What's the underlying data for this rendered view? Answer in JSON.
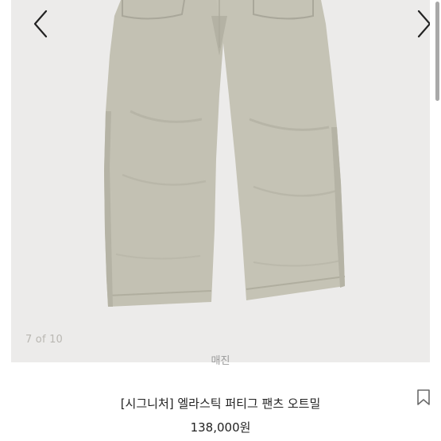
{
  "gallery": {
    "counter": "7 of 10",
    "prev_icon": "chevron-left-icon",
    "next_icon": "chevron-right-icon"
  },
  "product": {
    "brand": "매진",
    "title": "[시그니처] 엘라스틱 퍼티그 팬츠 오트밀",
    "price": "138,000원",
    "bookmark_icon": "bookmark-icon"
  },
  "colors": {
    "gallery_bg": "#ecebea",
    "pants": "#c3c1b3",
    "text": "#222222",
    "muted": "#9b9b9b"
  }
}
